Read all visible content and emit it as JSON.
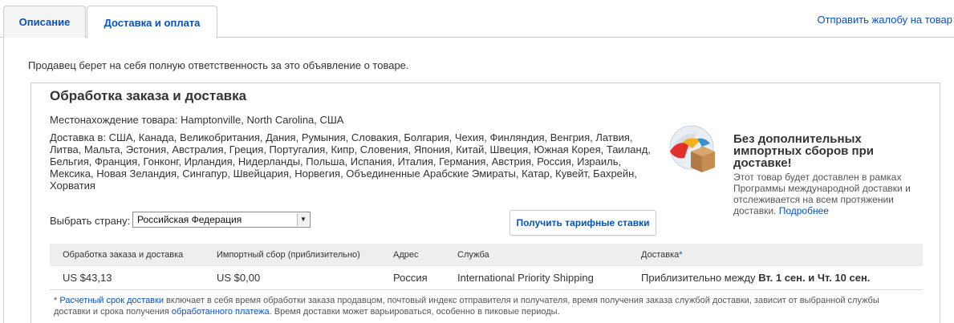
{
  "tabs": [
    {
      "label": "Описание"
    },
    {
      "label": "Доставка и оплата"
    }
  ],
  "complaint_link": "Отправить жалобу на товар",
  "intro": "Продавец берет на себя полную ответственность за это объявление о товаре.",
  "panel": {
    "title": "Обработка заказа и доставка",
    "location": "Местонахождение товара: Hamptonville, North Carolina, США",
    "ship_to": "Доставка в: США, Канада, Великобритания, Дания, Румыния, Словакия, Болгария, Чехия, Финляндия, Венгрия, Латвия, Литва, Мальта, Эстония, Австралия, Греция, Португалия, Кипр, Словения, Япония, Китай, Швеция, Южная Корея, Таиланд, Бельгия, Франция, Гонконг, Ирландия, Нидерланды, Польша, Испания, Италия, Германия, Австрия, Россия, Израиль, Мексика, Новая Зеландия, Сингапур, Швейцария, Норвегия, Объединенные Арабские Эмираты, Катар, Кувейт, Бахрейн, Хорватия"
  },
  "promo": {
    "icon": "globe-box-icon",
    "title": "Без дополнительных импортных сборов при доставке!",
    "text": "Этот товар будет доставлен в рамках Программы международной доставки и отслеживается на всем протяжении доставки.",
    "link": "Подробнее"
  },
  "country": {
    "label": "Выбрать страну:",
    "selected": "Российская Федерация"
  },
  "rates_button": "Получить тарифные ставки",
  "table": {
    "headers": [
      "Обработка заказа и доставка",
      "Импортный сбор (приблизительно)",
      "Адрес",
      "Служба",
      "Доставка"
    ],
    "header_star": "*",
    "row": {
      "cost": "US $43,13",
      "import_fee": "US $0,00",
      "address": "Россия",
      "service": "International Priority Shipping",
      "delivery_prefix": "Приблизительно между",
      "delivery_dates": "Вт. 1 сен. и Чт. 10 сен."
    }
  },
  "note": {
    "star": "*",
    "link1": "Расчетный срок доставки",
    "text1": " включает в себя время обработки заказа продавцом, почтовый индекс отправителя и получателя, время получения заказа службой доставки, зависит от выбранной службы доставки и срока получения ",
    "link2": "обработанного платежа",
    "text2": ". Время доставки может варьироваться, особенно в пиковые периоды."
  },
  "colors": {
    "link": "#0654ba",
    "border": "#cccccc",
    "header_bg": "#eeeeee"
  }
}
